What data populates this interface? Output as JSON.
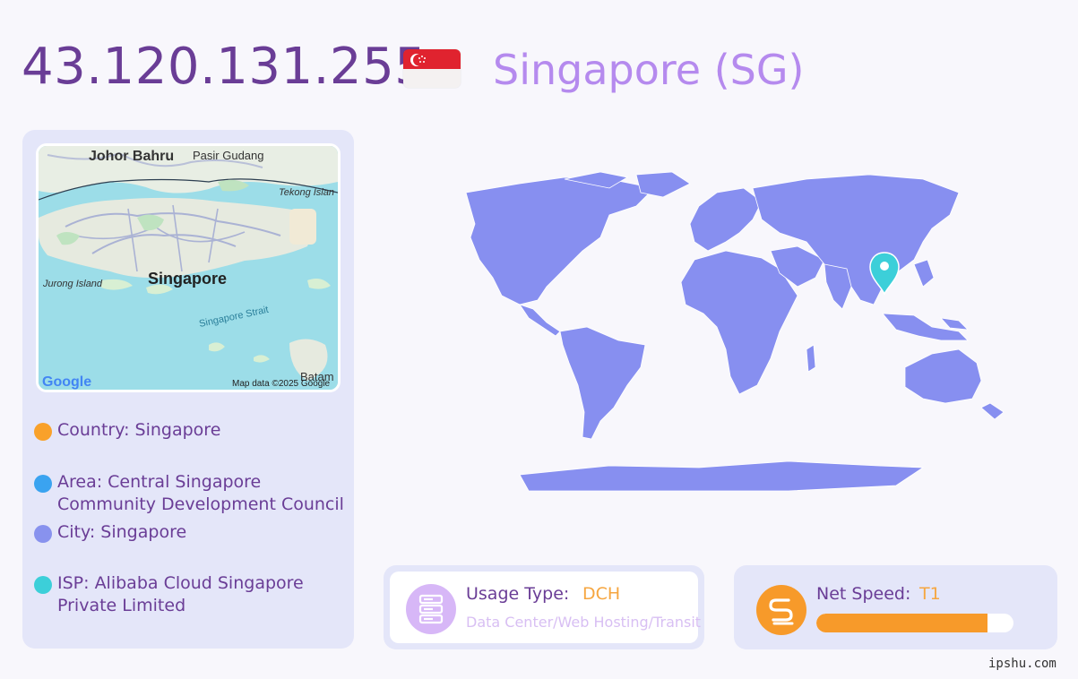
{
  "header": {
    "ip": "43.120.131.255",
    "country": "Singapore (SG)"
  },
  "map": {
    "labels": {
      "johor_bahru": "Johor Bahru",
      "pasir_gudang": "Pasir Gudang",
      "tekong_island": "Tekong Islan",
      "jurong_island": "Jurong Island",
      "singapore": "Singapore",
      "singapore_strait": "Singapore Strait",
      "batam": "Batam",
      "google": "Google",
      "attribution": "Map data ©2025 Google"
    }
  },
  "info": {
    "country": "Country: Singapore",
    "area": "Area: Central Singapore Community Development Council",
    "city": "City: Singapore",
    "isp": "ISP: Alibaba Cloud Singapore Private Limited",
    "colors": {
      "country": "#f9a12a",
      "area": "#3aa3f0",
      "city": "#8892ee",
      "isp": "#3ccfd9"
    }
  },
  "usage": {
    "label": "Usage Type:",
    "value": "DCH",
    "description": "Data Center/Web Hosting/Transit",
    "icon": "server-icon"
  },
  "speed": {
    "label": "Net Speed:",
    "value": "T1",
    "level": 0.87,
    "icon": "speed-icon"
  },
  "footer": {
    "site": "ipshu.com"
  },
  "colors": {
    "accent": "#6a3d96",
    "country_text": "#b58aee",
    "panel": "#e4e6f9",
    "land": "#878ff0",
    "marker": "#3ccfd9"
  }
}
